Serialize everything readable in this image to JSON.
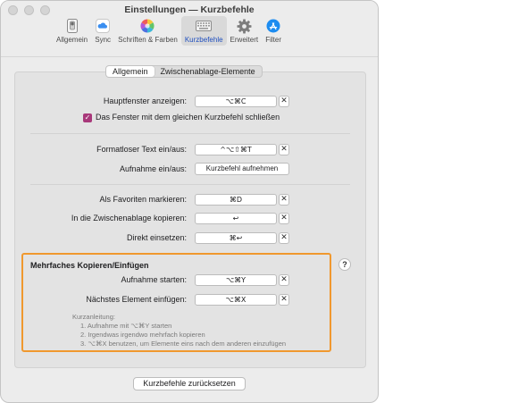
{
  "window": {
    "title": "Einstellungen — Kurzbefehle"
  },
  "toolbar": {
    "items": [
      {
        "label": "Allgemein",
        "icon": "switch-icon"
      },
      {
        "label": "Sync",
        "icon": "cloud-icon"
      },
      {
        "label": "Schriften & Farben",
        "icon": "color-wheel-icon"
      },
      {
        "label": "Kurzbefehle",
        "icon": "keyboard-icon",
        "selected": true
      },
      {
        "label": "Erweitert",
        "icon": "gear-icon"
      },
      {
        "label": "Filter",
        "icon": "app-store-icon"
      }
    ]
  },
  "tabs": [
    {
      "label": "Allgemein",
      "active": true
    },
    {
      "label": "Zwischenablage-Elemente",
      "active": false
    }
  ],
  "general": {
    "main_window": {
      "label": "Hauptfenster anzeigen:",
      "shortcut": "⌥⌘C"
    },
    "close_checkbox": {
      "label": "Das Fenster mit dem gleichen Kurzbefehl schließen",
      "checked": true
    },
    "plain_text": {
      "label": "Formatloser Text ein/aus:",
      "shortcut": "^⌥⇧⌘T"
    },
    "recording": {
      "label": "Aufnahme ein/aus:",
      "button": "Kurzbefehl aufnehmen"
    },
    "favorites": {
      "label": "Als Favoriten markieren:",
      "shortcut": "⌘D"
    },
    "copy_clipboard": {
      "label": "In die Zwischenablage kopieren:",
      "shortcut": "↩"
    },
    "paste_direct": {
      "label": "Direkt einsetzen:",
      "shortcut": "⌘↩"
    }
  },
  "multi": {
    "title": "Mehrfaches Kopieren/Einfügen",
    "start": {
      "label": "Aufnahme starten:",
      "shortcut": "⌥⌘Y"
    },
    "next": {
      "label": "Nächstes Element einfügen:",
      "shortcut": "⌥⌘X"
    },
    "hint_title": "Kurzanleitung:",
    "hints": [
      "1. Aufnahme mit ⌥⌘Y starten",
      "2. Irgendwas irgendwo mehrfach kopieren",
      "3. ⌥⌘X benutzen, um Elemente eins nach dem anderen einzufügen"
    ]
  },
  "clear_symbol": "✕",
  "help_symbol": "?",
  "reset_button": "Kurzbefehle zurücksetzen",
  "colors": {
    "accent": "#a8387a",
    "highlight": "#f0982e",
    "selected_tab_text": "#1f4fbf"
  }
}
